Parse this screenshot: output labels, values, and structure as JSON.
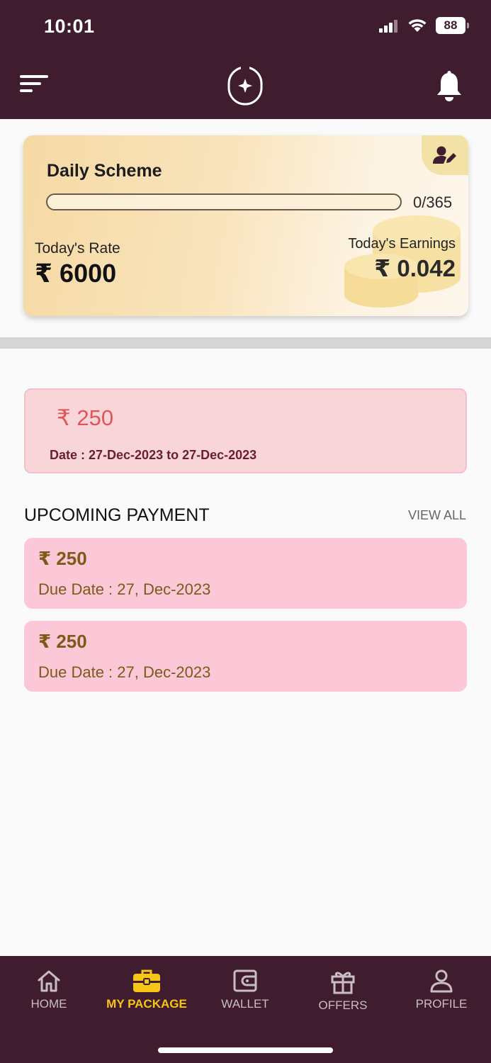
{
  "status_bar": {
    "time": "10:01",
    "battery": "88"
  },
  "header": {
    "menu_icon": "menu-icon",
    "logo_icon": "sparkle-logo-icon",
    "bell_icon": "bell-icon"
  },
  "scheme": {
    "title": "Daily Scheme",
    "progress_text": "0/365",
    "progress_fraction": 0,
    "rate_label": "Today's Rate",
    "rate_value": "₹ 6000",
    "earnings_label": "Today's Earnings",
    "earnings_value": "₹ 0.042",
    "edit_icon": "user-edit-icon"
  },
  "plan": {
    "amount": "₹ 250",
    "date_text": "Date : 27-Dec-2023  to  27-Dec-2023"
  },
  "upcoming": {
    "title": "UPCOMING PAYMENT",
    "view_all": "VIEW ALL",
    "items": [
      {
        "amount": "₹ 250",
        "due": "Due Date  : 27, Dec-2023"
      },
      {
        "amount": "₹ 250",
        "due": "Due Date  : 27, Dec-2023"
      }
    ]
  },
  "nav": {
    "items": [
      {
        "label": "HOME",
        "icon": "home-icon"
      },
      {
        "label": "MY PACKAGE",
        "icon": "briefcase-icon",
        "active": true
      },
      {
        "label": "WALLET",
        "icon": "wallet-icon"
      },
      {
        "label": "OFFERS",
        "icon": "gift-icon"
      },
      {
        "label": "PROFILE",
        "icon": "profile-icon"
      }
    ]
  },
  "colors": {
    "header_bg": "#3f1d2e",
    "nav_active": "#f5c518",
    "plan_amount": "#e0555a",
    "upcoming_card_bg": "#fcc7d6"
  }
}
